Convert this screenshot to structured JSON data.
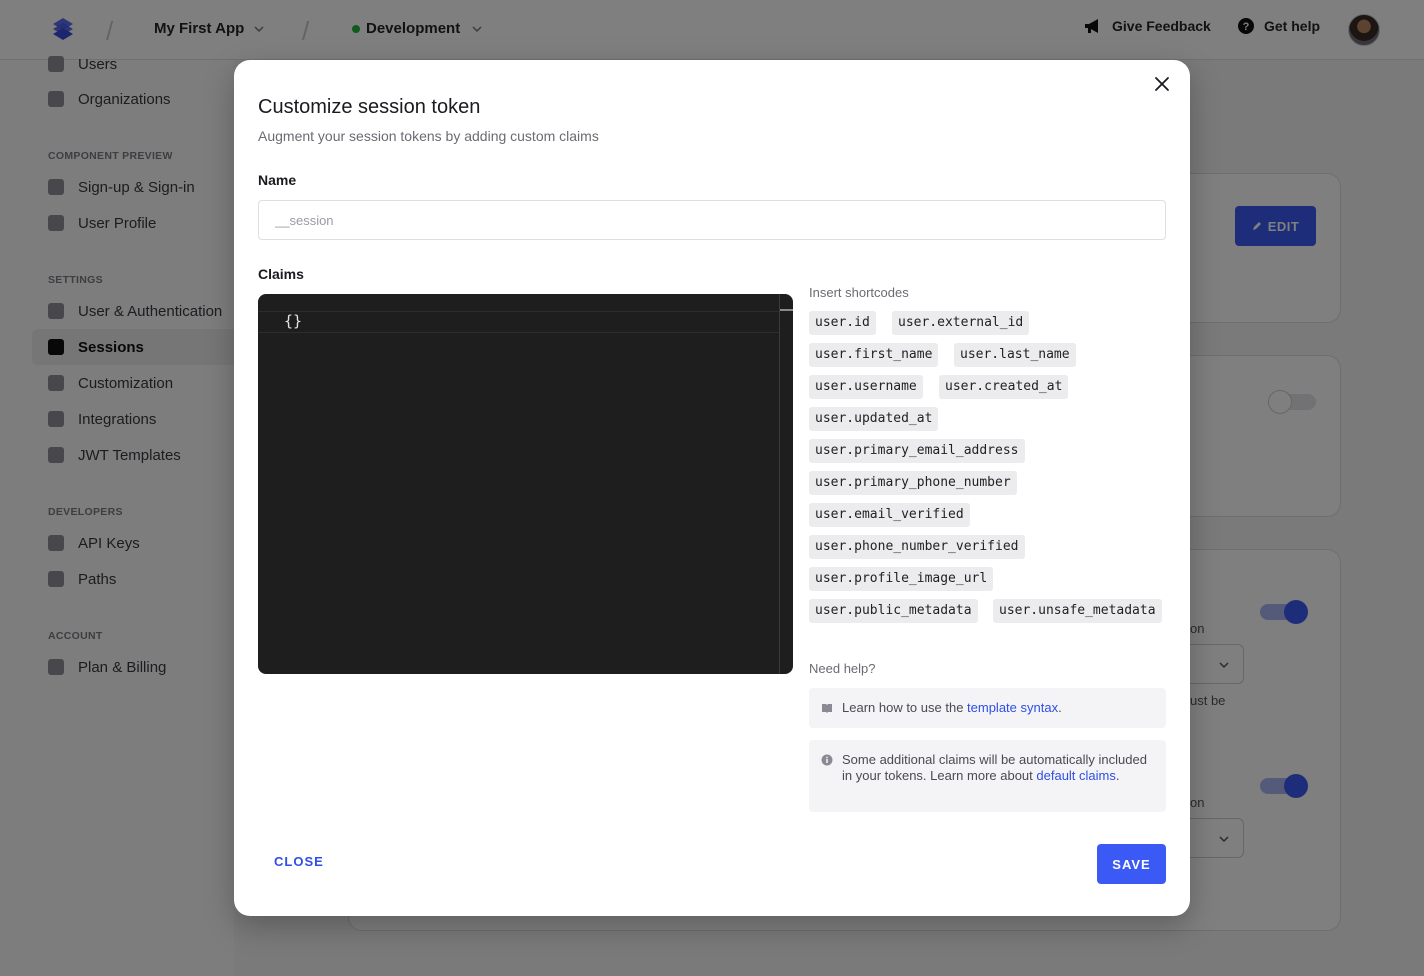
{
  "topbar": {
    "app_name": "My First App",
    "environment": "Development",
    "feedback": "Give Feedback",
    "help": "Get help"
  },
  "sidebar": {
    "items_top": [
      "Users",
      "Organizations"
    ],
    "section_preview": "COMPONENT PREVIEW",
    "items_preview": [
      "Sign-up & Sign-in",
      "User Profile"
    ],
    "section_settings": "SETTINGS",
    "items_settings": [
      "User & Authentication",
      "Sessions",
      "Customization",
      "Integrations",
      "JWT Templates"
    ],
    "section_developers": "DEVELOPERS",
    "items_developers": [
      "API Keys",
      "Paths"
    ],
    "section_account": "ACCOUNT",
    "items_account": [
      "Plan & Billing"
    ]
  },
  "background": {
    "edit_label": "EDIT",
    "fragment_1": "on",
    "fragment_2": "ust be",
    "fragment_3": "on"
  },
  "modal": {
    "title": "Customize session token",
    "subtitle": "Augment your session tokens by adding custom claims",
    "name_label": "Name",
    "name_placeholder": "__session",
    "claims_label": "Claims",
    "claims_code": "{}",
    "shortcodes_title": "Insert shortcodes",
    "shortcodes": [
      "user.id",
      "user.external_id",
      "user.first_name",
      "user.last_name",
      "user.username",
      "user.created_at",
      "user.updated_at",
      "user.primary_email_address",
      "user.primary_phone_number",
      "user.email_verified",
      "user.phone_number_verified",
      "user.profile_image_url",
      "user.public_metadata",
      "user.unsafe_metadata"
    ],
    "need_help_title": "Need help?",
    "help_1_prefix": "Learn how to use the ",
    "help_1_link": "template syntax",
    "help_1_suffix": ".",
    "help_2_prefix": "Some additional claims will be automatically included in your tokens. Learn more about ",
    "help_2_link": "default claims",
    "help_2_suffix": ".",
    "close_label": "CLOSE",
    "save_label": "SAVE"
  },
  "colors": {
    "accent": "#3b5af5",
    "link": "#2f4ee8",
    "editor_bg": "#1e1e1e",
    "status_green": "#20b53b"
  }
}
